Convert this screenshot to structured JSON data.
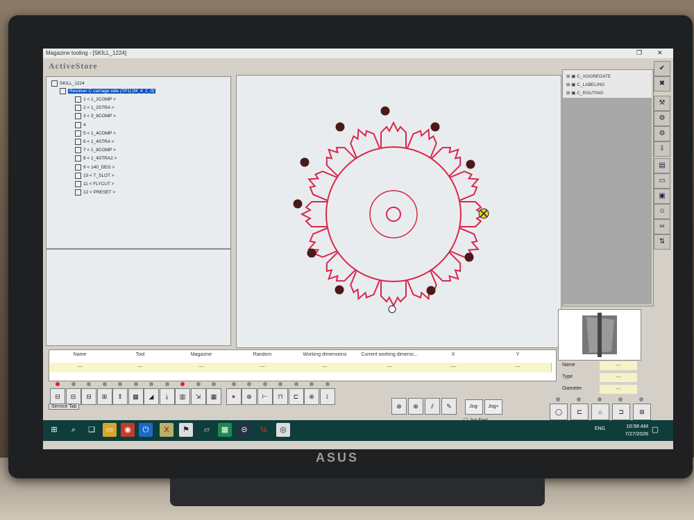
{
  "window": {
    "title": "Magazine tooling - [SKILL_1224]",
    "restore_icon": "restore-icon",
    "close_glyph": "✕",
    "app_logo": "ActiveStore"
  },
  "tree": {
    "root": "SKILL_1224",
    "node": "Revolver C carriage side (TP1) [M_4_2_0]",
    "items": [
      "1 < 1_2COMP >",
      "2 < 1_2STRA >",
      "3 < 3_8COMP >",
      "4",
      "5 < 1_4COMP >",
      "6 < 1_4STRA >",
      "7 < 1_8COMP >",
      "8 < 1_4STRA2 >",
      "9 < 140_DEG >",
      "10 < T_SLOT >",
      "11 < FLYCUT >",
      "12 < PRESET >"
    ]
  },
  "right_list": [
    "C_AGGREGATE",
    "C_LABELING",
    "C_ROUTING"
  ],
  "props": {
    "name_label": "Name",
    "type_label": "Type",
    "diameter_label": "Diameter",
    "name_value": "---",
    "type_value": "---",
    "diameter_value": "---"
  },
  "grid": {
    "headers": [
      "Name",
      "Tool",
      "Magazine",
      "Random",
      "Working dimensions",
      "Current working dimensi...",
      "X",
      "Y"
    ],
    "values": [
      "---",
      "---",
      "---",
      "---",
      "---",
      "---",
      "----",
      "---"
    ]
  },
  "service_tab": "Service Tab",
  "jog": {
    "minus": "Jog-",
    "plus": "Jog+",
    "fast": "Jog Fast"
  },
  "taskbar": {
    "lang": "ENG",
    "time": "10:58 AM",
    "date": "7/27/2026"
  },
  "monitor": {
    "brand": "ASUS"
  },
  "colors": {
    "tool_outline": "#d8264a",
    "selection": "#0a54c4",
    "taskbar": "#0f3d3b",
    "field_bg": "#f6f6c8"
  }
}
